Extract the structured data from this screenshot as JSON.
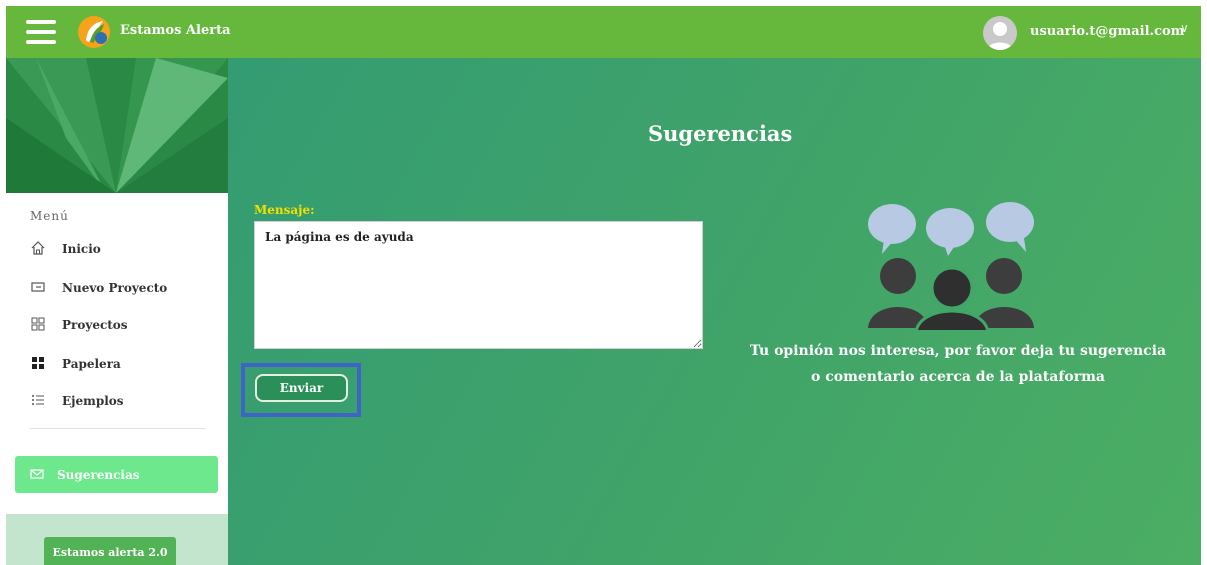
{
  "header": {
    "brand": "Estamos Alerta",
    "user_email": "usuario.t@gmail.com",
    "user_chevron": "∨"
  },
  "sidebar": {
    "menu_title": "Menú",
    "items": [
      {
        "label": "Inicio",
        "icon": "home-icon"
      },
      {
        "label": "Nuevo Proyecto",
        "icon": "new-project-icon"
      },
      {
        "label": "Proyectos",
        "icon": "grid-icon"
      },
      {
        "label": "Papelera",
        "icon": "trash-grid-icon"
      },
      {
        "label": "Ejemplos",
        "icon": "list-icon"
      }
    ],
    "active_item": {
      "label": "Sugerencias",
      "icon": "mail-icon"
    },
    "footer_button": "Estamos alerta 2.0"
  },
  "main": {
    "title": "Sugerencias",
    "message_label": "Mensaje:",
    "message_value": "La página es de ayuda",
    "send_label": "Enviar",
    "cta_line1": "Tu opinión nos interesa, por favor deja tu sugerencia",
    "cta_line2": "o comentario acerca de la plataforma"
  },
  "colors": {
    "topbar": "#65b83c",
    "active_item": "#6ee88d",
    "label_yellow": "#f3e000",
    "highlight_border": "#3f64c7"
  }
}
